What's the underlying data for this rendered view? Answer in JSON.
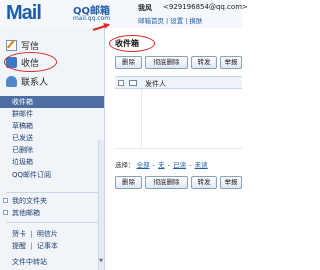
{
  "header": {
    "logo": "Mail",
    "brand_cn": "QQ邮箱",
    "brand_sub": "mail.qq.com",
    "user_name": "我风",
    "user_email": "<929196854@qq.com>",
    "links": [
      "邮箱首页",
      "设置",
      "换肤"
    ]
  },
  "sidebar": {
    "write_label": "写信",
    "receive_label": "收信",
    "contacts_label": "联系人",
    "folders": [
      "收件箱",
      "群邮件",
      "草稿箱",
      "已发送",
      "已删除",
      "垃圾箱",
      "QQ邮件订阅"
    ],
    "my_folders": "我的文件夹",
    "other_mailboxes": "其他邮箱",
    "apps": [
      "贺卡",
      "明信片",
      "提醒",
      "记事本",
      "文件中转站"
    ],
    "highlighted": "收信"
  },
  "main": {
    "title": "收件箱",
    "toolbar": [
      "删除",
      "彻底删除",
      "转发",
      "举报"
    ],
    "list_header": {
      "sender": "发件人"
    },
    "select": {
      "label": "选择：",
      "all": "全部",
      "none": "无",
      "read": "已读",
      "unread": "未读"
    }
  },
  "colors": {
    "brand": "#1e5ea8",
    "selected_folder": "#4e6ea3",
    "sidebar_bg": "#f1f5fa",
    "annotation": "#d62a2a"
  }
}
